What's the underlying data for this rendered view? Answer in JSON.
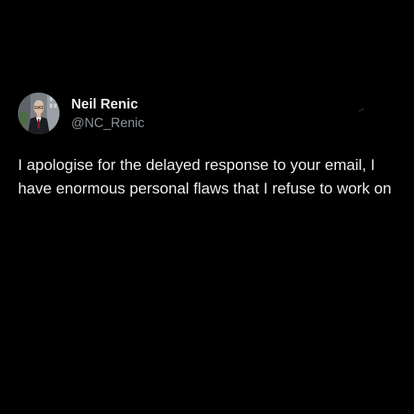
{
  "tweet": {
    "author": {
      "display_name": "Neil Renic",
      "handle": "@NC_Renic",
      "avatar_icon": "profile-photo-icon"
    },
    "text": "I apologise for the delayed response to your email, I have enormous personal flaws that I refuse to work on"
  },
  "colors": {
    "background": "#000000",
    "primary_text": "#e7e9ea",
    "secondary_text": "#8b9095"
  }
}
